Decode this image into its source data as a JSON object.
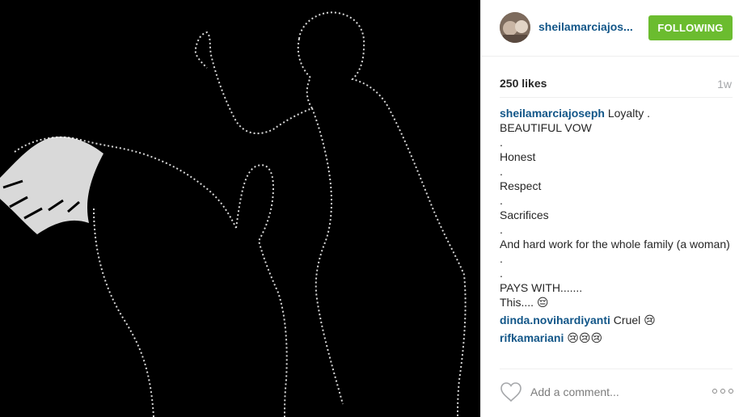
{
  "post": {
    "image_icon": "silhouette-illustration"
  },
  "header": {
    "username": "sheilamarciajos...",
    "follow_label": "FOLLOWING",
    "avatar_icon": "profile-photo"
  },
  "stats": {
    "likes": "250 likes",
    "time": "1w"
  },
  "caption": {
    "user": "sheilamarciajoseph",
    "lines": [
      "Loyalty .",
      "BEAUTIFUL VOW",
      ".",
      "Honest",
      ".",
      "Respect",
      ".",
      "Sacrifices",
      ".",
      "And hard work for the whole family (a woman)",
      ".",
      ".",
      "PAYS WITH.......",
      "This.... 😔"
    ]
  },
  "comments": [
    {
      "user": "dinda.novihardiyanti",
      "text": "Cruel 😢"
    },
    {
      "user": "rifkamariani",
      "text": "😢😢😢"
    }
  ],
  "footer": {
    "comment_placeholder": "Add a comment...",
    "like_icon": "heart-icon",
    "more_icon": "more-options-icon"
  },
  "colors": {
    "follow_bg": "#6bbc2f",
    "username": "#125688",
    "media_bg": "#000000"
  }
}
